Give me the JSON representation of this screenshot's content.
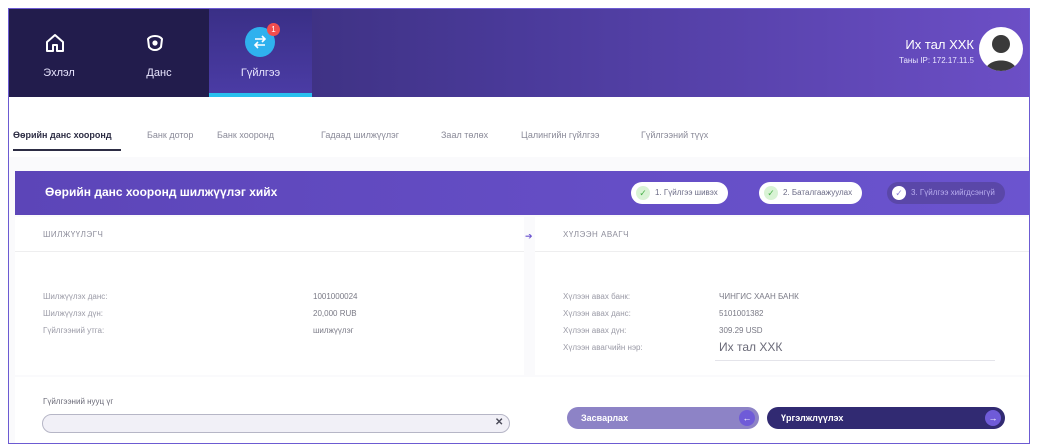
{
  "header": {
    "nav": [
      {
        "label": "Эхлэл",
        "icon": "home-icon"
      },
      {
        "label": "Данс",
        "icon": "wallet-icon"
      },
      {
        "label": "Гүйлгээ",
        "icon": "transfer-icon",
        "badge": "1",
        "active": true
      }
    ],
    "user_name": "Их тал ХХК",
    "user_ip": "Таны IP: 172.17.11.5"
  },
  "subtabs": [
    {
      "label": "Өөрийн данс хооронд",
      "active": true
    },
    {
      "label": "Банк дотор"
    },
    {
      "label": "Банк хооронд"
    },
    {
      "label": "Гадаад шилжүүлэг"
    },
    {
      "label": "Заал төлөх"
    },
    {
      "label": "Цалингийн гүйлгээ"
    },
    {
      "label": "Гүйлгээний түүх"
    }
  ],
  "form": {
    "title": "Өөрийн данс хооронд шилжүүлэг хийх",
    "steps": [
      {
        "label": "1. Гүйлгээ шивэх",
        "done": true
      },
      {
        "label": "2. Баталгаажуулах",
        "done": true
      },
      {
        "label": "3. Гүйлгээ хийгдсэнгүй",
        "done": false
      }
    ],
    "sender": {
      "heading": "ШИЛЖҮҮЛЭГЧ",
      "rows": [
        {
          "label": "Шилжүүлэх данс:",
          "value": "1001000024"
        },
        {
          "label": "Шилжүүлэх дүн:",
          "value": "20,000 RUB"
        },
        {
          "label": "Гүйлгээний утга:",
          "value": "шилжүүлэг"
        }
      ]
    },
    "receiver": {
      "heading": "ХҮЛЭЭН АВАГЧ",
      "rows": [
        {
          "label": "Хүлээн авах банк:",
          "value": "ЧИНГИС ХААН БАНК"
        },
        {
          "label": "Хүлээн авах данс:",
          "value": "5101001382"
        },
        {
          "label": "Хүлээн авах дүн:",
          "value": "309.29 USD"
        },
        {
          "label": "Хүлээн авагчийн нэр:",
          "value": "Их тал ХХК"
        }
      ]
    },
    "password": {
      "label": "Гүйлгээний нууц үг",
      "value": "",
      "placeholder": ""
    },
    "buttons": {
      "edit": "Засварлах",
      "confirm": "Үргэлжлүүлэх"
    }
  },
  "colors": {
    "primary": "#5c45b8",
    "dark": "#221c4c",
    "accent": "#29c0ee",
    "badge": "#f24d4d"
  }
}
